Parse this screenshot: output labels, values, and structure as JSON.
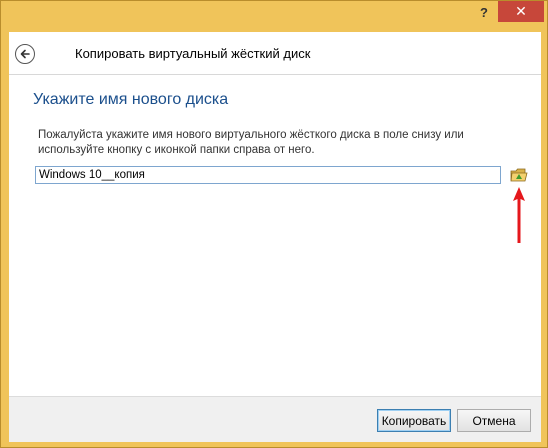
{
  "window": {
    "help_label": "?",
    "close_label": "✕"
  },
  "header": {
    "back_icon": "back-arrow-icon",
    "title": "Копировать виртуальный жёсткий диск"
  },
  "main": {
    "heading": "Укажите имя нового диска",
    "instructions": "Пожалуйста укажите имя нового виртуального жёсткого диска в поле снизу или используйте кнопку с иконкой папки справа от него.",
    "disk_name_value": "Windows 10__копия",
    "folder_icon": "folder-browse-icon"
  },
  "footer": {
    "copy_label": "Копировать",
    "cancel_label": "Отмена"
  },
  "colors": {
    "window_frame": "#f0c45a",
    "heading": "#1b4f8c",
    "close_button": "#c7473a",
    "annotation_arrow": "#e5171c"
  }
}
